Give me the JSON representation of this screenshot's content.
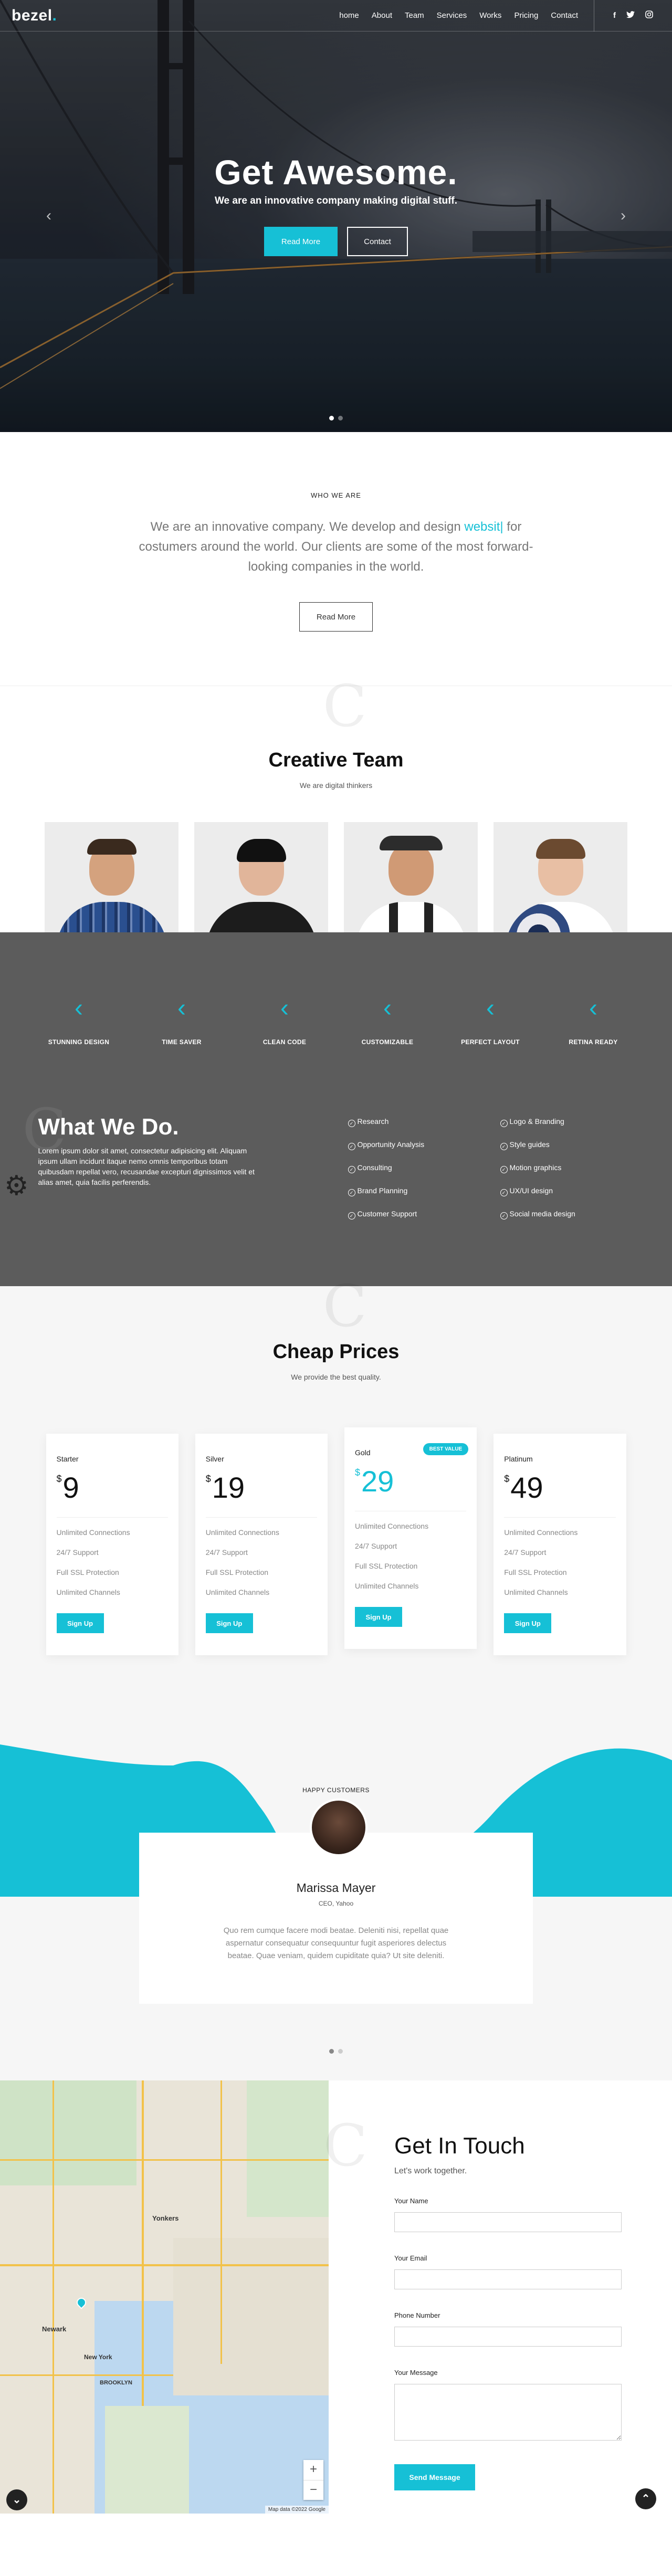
{
  "brand": {
    "name": "bezel",
    "dot": "."
  },
  "nav": {
    "items": [
      "home",
      "About",
      "Team",
      "Services",
      "Works",
      "Pricing",
      "Contact"
    ],
    "social": [
      "f",
      "t",
      "o"
    ]
  },
  "hero": {
    "title": "Get Awesome.",
    "subtitle": "We are an innovative company making digital stuff.",
    "primary_label": "Read More",
    "secondary_label": "Contact",
    "prev": "‹",
    "next": "›"
  },
  "about": {
    "label": "WHO WE ARE",
    "text_before": "We are an innovative company. We develop and design ",
    "highlight": "websit|",
    "text_after": " for costumers around the world. Our clients are some of the most forward-looking companies in the world.",
    "button": "Read More"
  },
  "team": {
    "ghost": "C",
    "title": "Creative Team",
    "subtitle": "We are digital thinkers"
  },
  "features": [
    {
      "icon": "chevron-left-icon",
      "glyph": "‹",
      "label": "STUNNING DESIGN"
    },
    {
      "icon": "chevron-left-icon",
      "glyph": "‹",
      "label": "TIME SAVER"
    },
    {
      "icon": "chevron-left-icon",
      "glyph": "‹",
      "label": "CLEAN CODE"
    },
    {
      "icon": "chevron-left-icon",
      "glyph": "‹",
      "label": "CUSTOMIZABLE"
    },
    {
      "icon": "chevron-left-icon",
      "glyph": "‹",
      "label": "PERFECT LAYOUT"
    },
    {
      "icon": "chevron-left-icon",
      "glyph": "‹",
      "label": "RETINA READY"
    }
  ],
  "whatwedo": {
    "ghost": "C",
    "title": "What We Do.",
    "text": "Lorem ipsum dolor sit amet, consectetur adipisicing elit. Aliquam ipsum ullam incidunt itaque nemo omnis temporibus totam quibusdam repellat vero, recusandae excepturi dignissimos velit et alias amet, quia facilis perferendis.",
    "col1": [
      "Research",
      "Opportunity Analysis",
      "Consulting",
      "Brand Planning",
      "Customer Support"
    ],
    "col2": [
      "Logo & Branding",
      "Style guides",
      "Motion graphics",
      "UX/UI design",
      "Social media design"
    ]
  },
  "pricing": {
    "ghost": "C",
    "title": "Cheap Prices",
    "subtitle": "We provide the best quality.",
    "currency": "$",
    "plans": [
      {
        "name": "Starter",
        "price": "9",
        "features": [
          "Unlimited Connections",
          "24/7 Support",
          "Full SSL Protection",
          "Unlimited Channels"
        ],
        "button": "Sign Up"
      },
      {
        "name": "Silver",
        "price": "19",
        "features": [
          "Unlimited Connections",
          "24/7 Support",
          "Full SSL Protection",
          "Unlimited Channels"
        ],
        "button": "Sign Up"
      },
      {
        "name": "Gold",
        "price": "29",
        "badge": "BEST VALUE",
        "features": [
          "Unlimited Connections",
          "24/7 Support",
          "Full SSL Protection",
          "Unlimited Channels"
        ],
        "button": "Sign Up"
      },
      {
        "name": "Platinum",
        "price": "49",
        "features": [
          "Unlimited Connections",
          "24/7 Support",
          "Full SSL Protection",
          "Unlimited Channels"
        ],
        "button": "Sign Up"
      }
    ]
  },
  "testimonial": {
    "label": "HAPPY CUSTOMERS",
    "name": "Marissa Mayer",
    "role": "CEO, Yahoo",
    "quote": "Quo rem cumque facere modi beatae. Deleniti nisi, repellat quae aspernatur consequatur consequuntur fugit asperiores delectus beatae. Quae veniam, quidem cupiditate quia? Ut site deleniti."
  },
  "map": {
    "labels": [
      "Yonkers",
      "Newark",
      "New York",
      "BROOKLYN"
    ],
    "zoom_in": "+",
    "zoom_out": "−",
    "attribution": "Map data ©2022 Google"
  },
  "contact": {
    "ghost": "C",
    "title": "Get In Touch",
    "subtitle": "Let's work together.",
    "fields": {
      "name": "Your Name",
      "email": "Your Email",
      "phone": "Phone Number",
      "message": "Your Message"
    },
    "button": "Send Message"
  },
  "colors": {
    "accent": "#16c0d6",
    "dark_section": "#5c5c5c"
  }
}
